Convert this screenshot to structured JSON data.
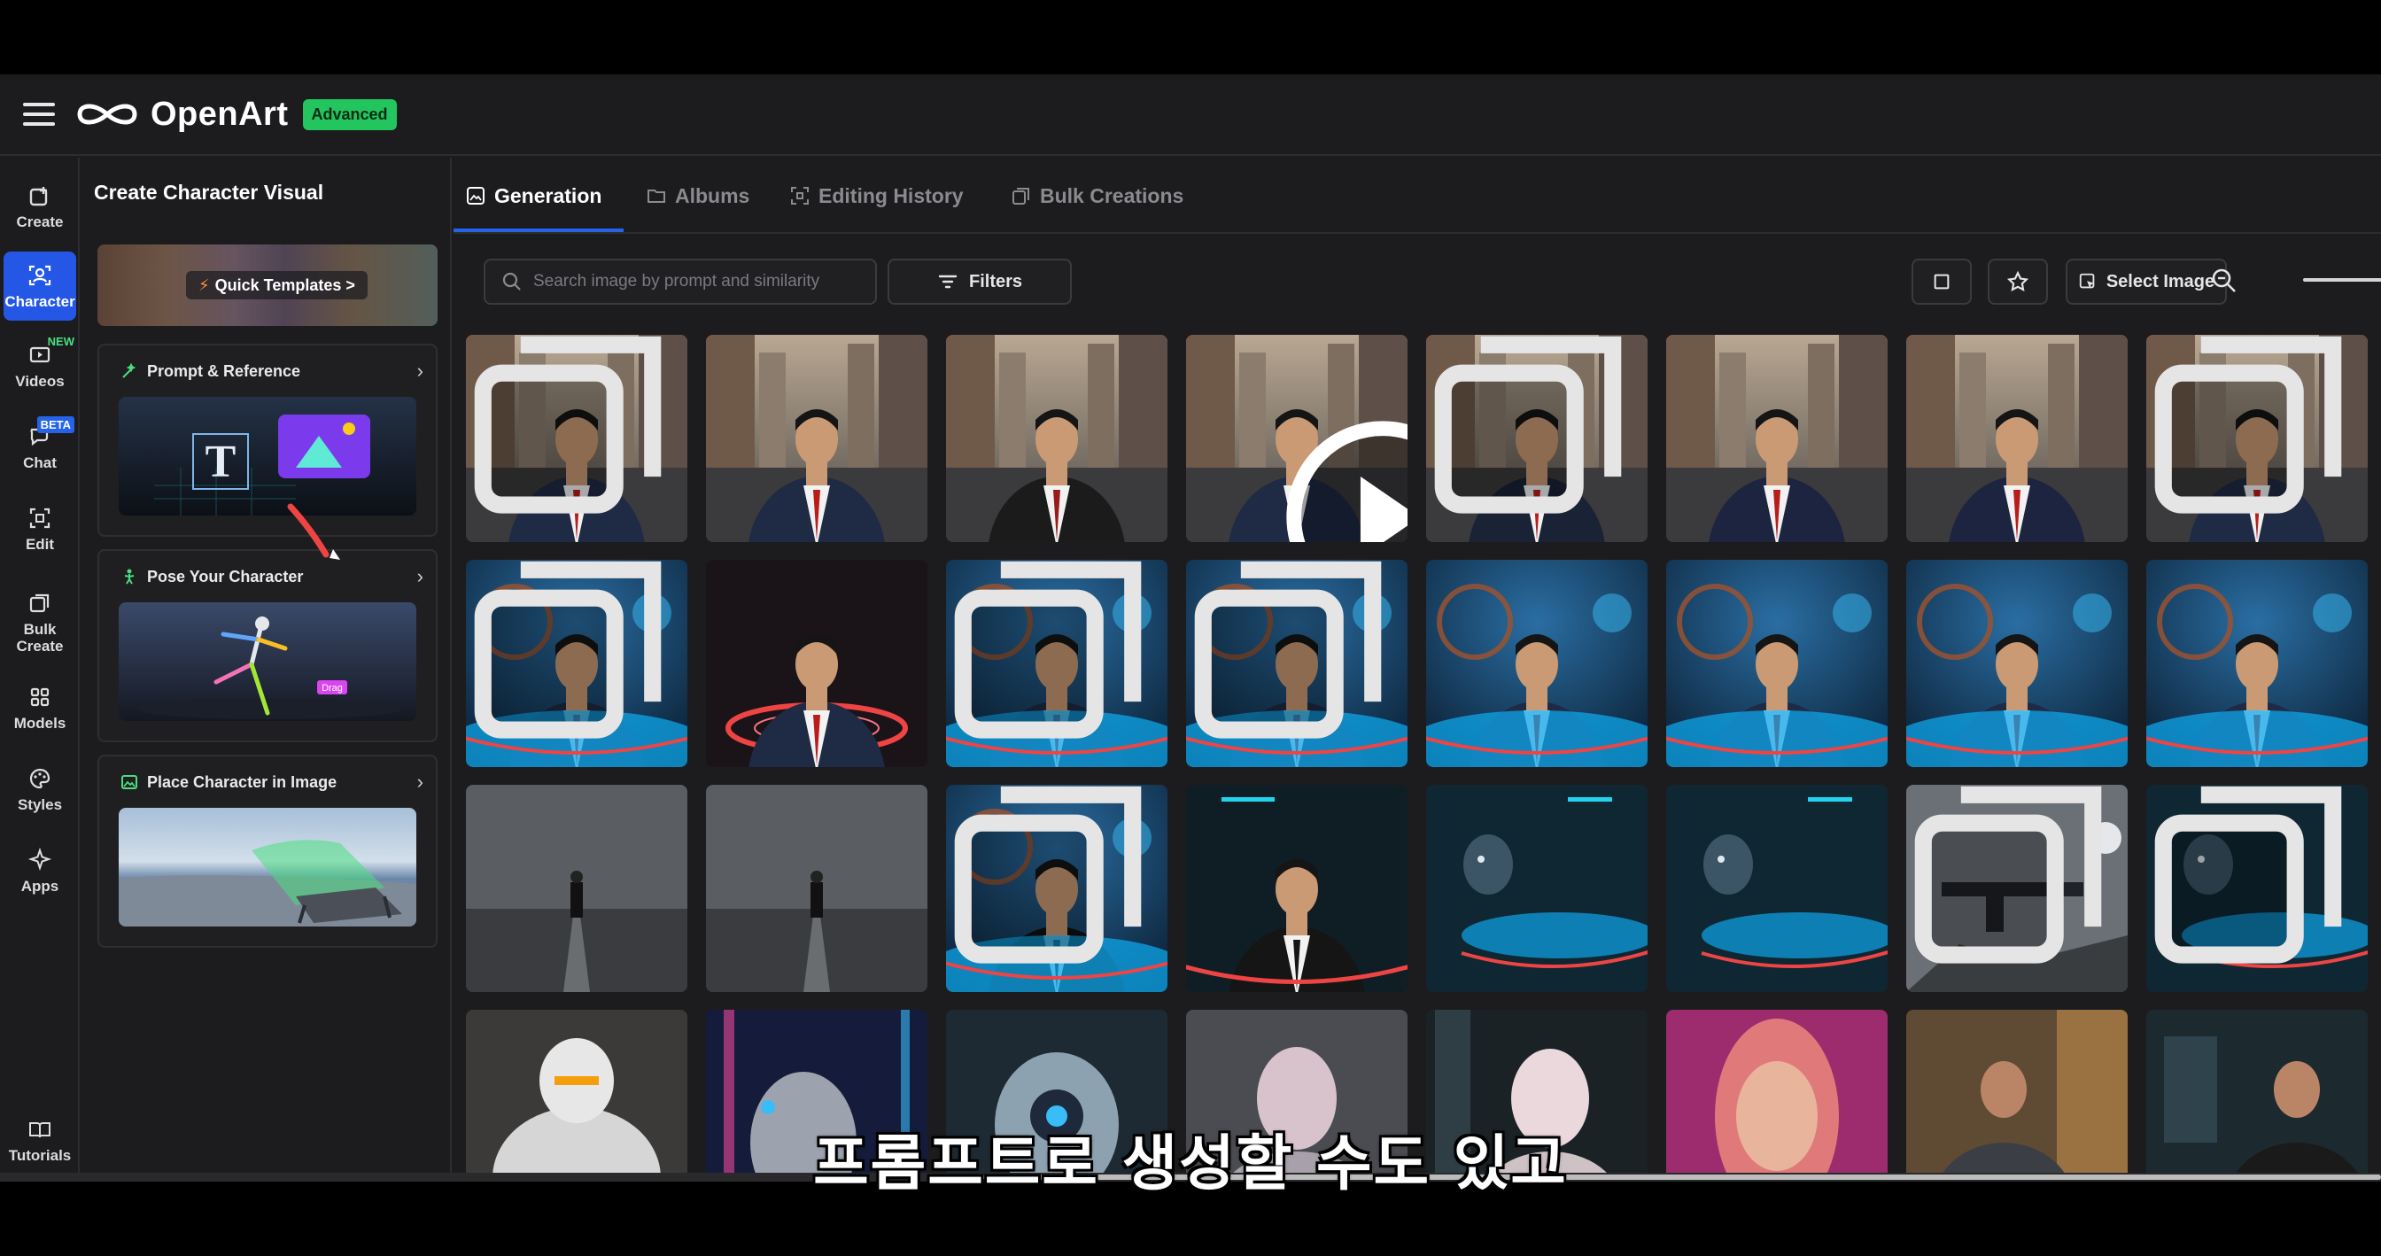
{
  "app": {
    "brand": "OpenArt",
    "plan_badge": "Advanced",
    "colors": {
      "accent": "#2563eb",
      "badge": "#22c55e",
      "background": "#1c1c1e"
    }
  },
  "rail": [
    {
      "label": "Create",
      "icon": "create-icon",
      "tag": ""
    },
    {
      "label": "Character",
      "icon": "character-icon",
      "tag": "",
      "active": true
    },
    {
      "label": "Videos",
      "icon": "videos-icon",
      "tag": "NEW"
    },
    {
      "label": "Chat",
      "icon": "chat-icon",
      "tag": "BETA"
    },
    {
      "label": "Edit",
      "icon": "edit-icon",
      "tag": ""
    },
    {
      "label": "Bulk Create",
      "icon": "bulk-create-icon",
      "tag": ""
    },
    {
      "label": "Models",
      "icon": "models-icon",
      "tag": ""
    },
    {
      "label": "Styles",
      "icon": "styles-icon",
      "tag": ""
    },
    {
      "label": "Apps",
      "icon": "apps-icon",
      "tag": ""
    },
    {
      "label": "Tutorials",
      "icon": "tutorials-icon",
      "tag": ""
    }
  ],
  "panel": {
    "title": "Create Character Visual",
    "quick_templates": "Quick Templates >",
    "cards": [
      {
        "title": "Prompt & Reference",
        "icon": "prompt-icon"
      },
      {
        "title": "Pose Your Character",
        "icon": "pose-icon",
        "drag_label": "Drag"
      },
      {
        "title": "Place Character in Image",
        "icon": "image-icon"
      }
    ]
  },
  "tabs": [
    {
      "label": "Generation",
      "active": true
    },
    {
      "label": "Albums"
    },
    {
      "label": "Editing History"
    },
    {
      "label": "Bulk Creations"
    }
  ],
  "toolbar": {
    "search_placeholder": "Search image by prompt and similarity",
    "filters": "Filters",
    "select_image": "Select Image"
  },
  "gallery": {
    "rows": [
      [
        "city-suit",
        "city-suit",
        "city-vest",
        "city-suit-video",
        "city-suit-walk",
        "city-suit-close",
        "city-suit-close",
        "city-suit"
      ],
      [
        "neon-table",
        "red-ring-table",
        "neon-table",
        "neon-table",
        "neon-table",
        "neon-table",
        "neon-table",
        "neon-table"
      ],
      [
        "foggy-road",
        "foggy-road",
        "blue-table-vest",
        "dark-table",
        "robot-table",
        "robot-table",
        "robot-gun",
        "robot-table"
      ],
      [
        "white-robot",
        "neon-cyborg",
        "android-head",
        "pink-android",
        "pink-android-city",
        "pink-woman",
        "soldier-street",
        "dark-alley"
      ]
    ]
  },
  "subtitle": "프롬프트로 생성할 수도 있고"
}
